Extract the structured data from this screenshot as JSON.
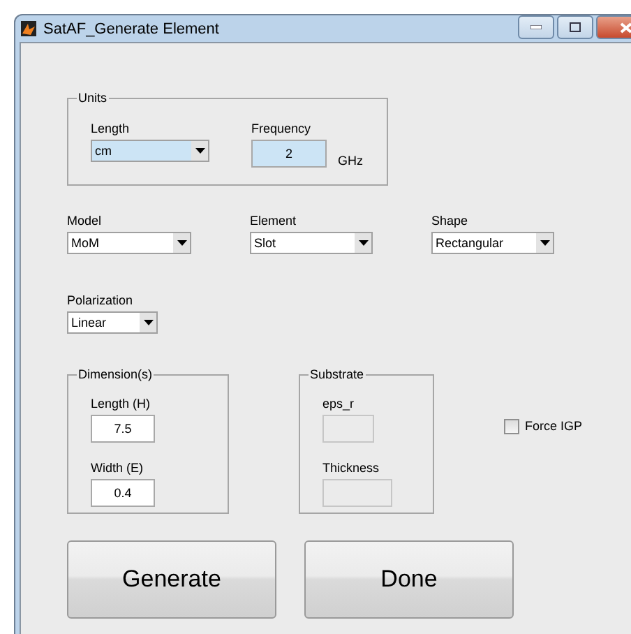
{
  "window": {
    "title": "SatAF_Generate Element"
  },
  "units": {
    "title": "Units",
    "fields": [
      {
        "kind": "select",
        "label": "Length",
        "value": "cm",
        "highlighted": true
      },
      {
        "kind": "input",
        "label": "Frequency",
        "value": "2",
        "unit": "GHz",
        "highlighted": true
      }
    ]
  },
  "selects": [
    {
      "label": "Model",
      "value": "MoM"
    },
    {
      "label": "Element",
      "value": "Slot"
    },
    {
      "label": "Shape",
      "value": "Rectangular"
    }
  ],
  "polarization": {
    "label": "Polarization",
    "value": "Linear"
  },
  "dimensions": {
    "title": "Dimension(s)",
    "fields": [
      {
        "label": "Length (H)",
        "value": "7.5",
        "disabled": false
      },
      {
        "label": "Width (E)",
        "value": "0.4",
        "disabled": false
      }
    ]
  },
  "substrate": {
    "title": "Substrate",
    "fields": [
      {
        "label": "eps_r",
        "disabled": true
      },
      {
        "label": "Thickness",
        "disabled": true
      }
    ]
  },
  "force_igp": {
    "label": "Force IGP",
    "checked": false
  },
  "buttons": [
    "Generate",
    "Done"
  ]
}
